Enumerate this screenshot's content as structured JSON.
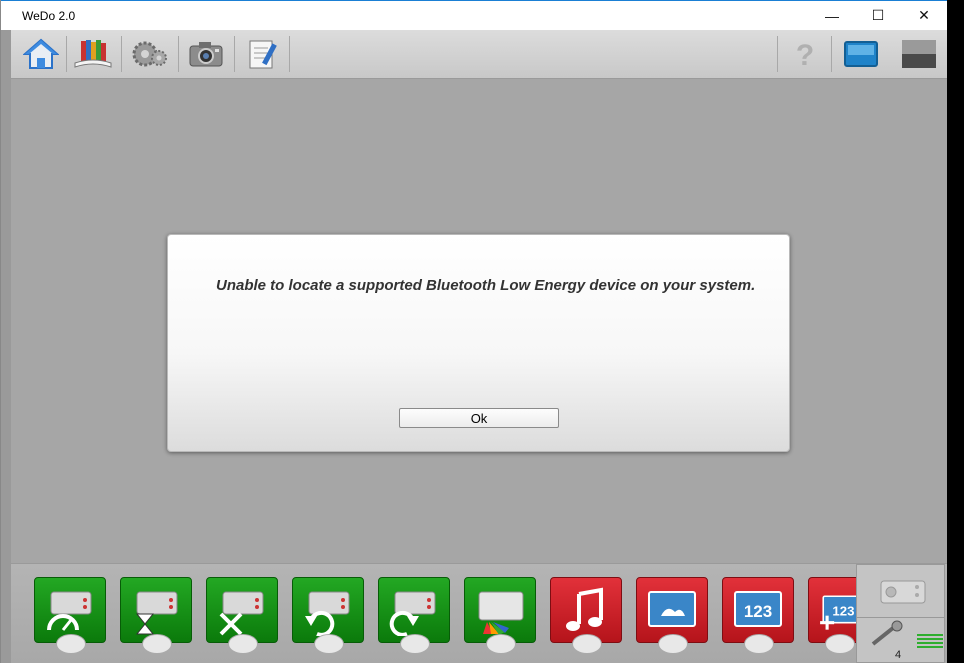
{
  "window": {
    "title": "WeDo 2.0",
    "minimize": "—",
    "maximize": "☐",
    "close": "✕"
  },
  "dialog": {
    "message": "Unable to locate a supported Bluetooth Low Energy device on your system.",
    "ok_label": "Ok"
  },
  "palette": {
    "counter": "4"
  },
  "colors": {
    "green_block": "#179a17",
    "red_block": "#d3222a",
    "canvas": "#a6a6a6"
  }
}
